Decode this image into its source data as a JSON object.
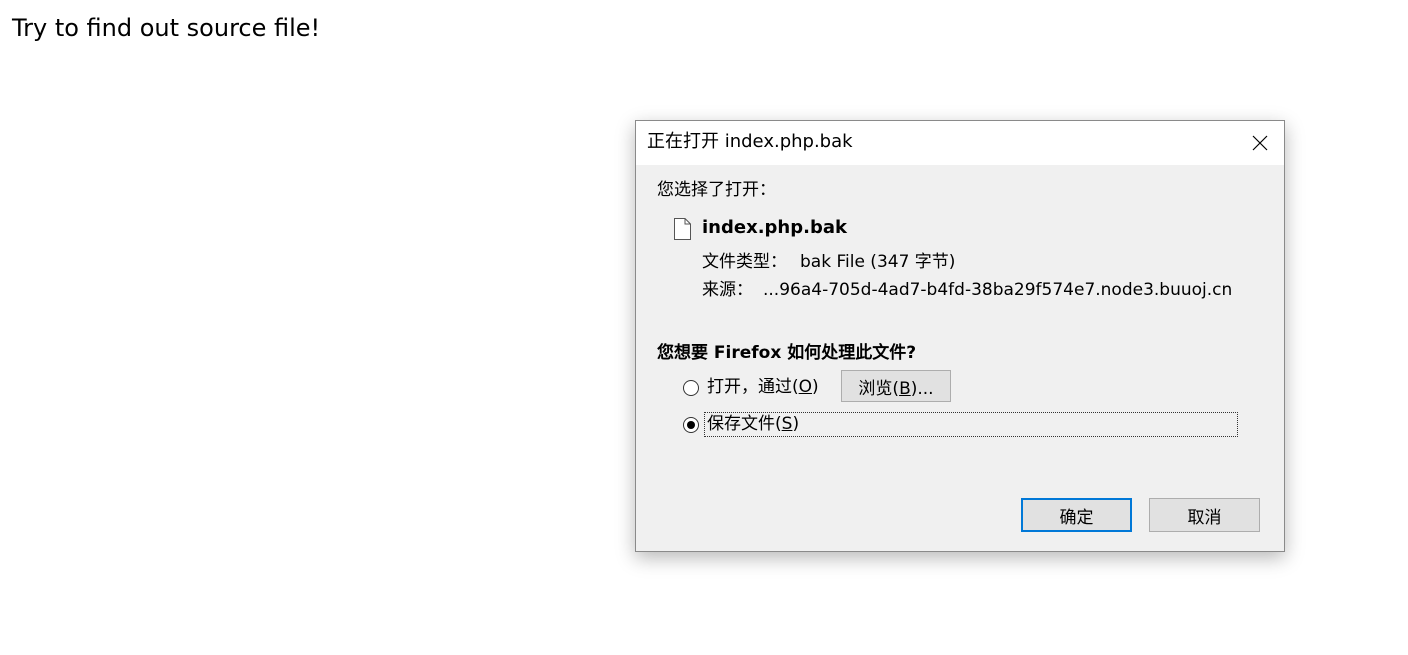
{
  "page": {
    "heading": "Try to find out source file!"
  },
  "dialog": {
    "title": "正在打开 index.php.bak",
    "close_icon": "close-icon",
    "intro_text": "您选择了打开：",
    "file": {
      "icon": "file-icon",
      "name": "index.php.bak",
      "type_label": "文件类型：",
      "type_value": "bak File (347 字节)",
      "source_label": "来源：",
      "source_value": "...96a4-705d-4ad7-b4fd-38ba29f574e7.node3.buuoj.cn"
    },
    "question": "您想要 Firefox 如何处理此文件?",
    "options": {
      "open_with": {
        "label": "打开，通过(",
        "accesskey": "O",
        "label_end": ")",
        "checked": false
      },
      "browse_button": {
        "label": "浏览(",
        "accesskey": "B",
        "label_end": ")..."
      },
      "save_file": {
        "label": "保存文件(",
        "accesskey": "S",
        "label_end": ")",
        "checked": true
      }
    },
    "buttons": {
      "ok": "确定",
      "cancel": "取消"
    },
    "colors": {
      "default_button_border": "#0078d7",
      "dialog_background": "#f0f0f0",
      "titlebar_background": "#ffffff"
    }
  }
}
